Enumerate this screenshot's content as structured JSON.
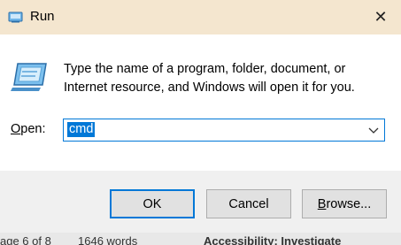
{
  "window": {
    "title": "Run",
    "close_glyph": "✕"
  },
  "dialog": {
    "description": "Type the name of a program, folder, document, or Internet resource, and Windows will open it for you.",
    "open_label_accel": "O",
    "open_label_rest": "pen:",
    "open_value": "cmd",
    "icon": "run-icon"
  },
  "buttons": {
    "ok": "OK",
    "cancel": "Cancel",
    "browse_accel": "B",
    "browse_rest": "rowse..."
  },
  "background_status": {
    "page": "age 6 of 8",
    "words": "1646 words",
    "accessibility": "Accessibility: Investigate"
  },
  "colors": {
    "titlebar": "#f4e6cf",
    "accent": "#0078d7",
    "footer": "#f0f0f0"
  }
}
